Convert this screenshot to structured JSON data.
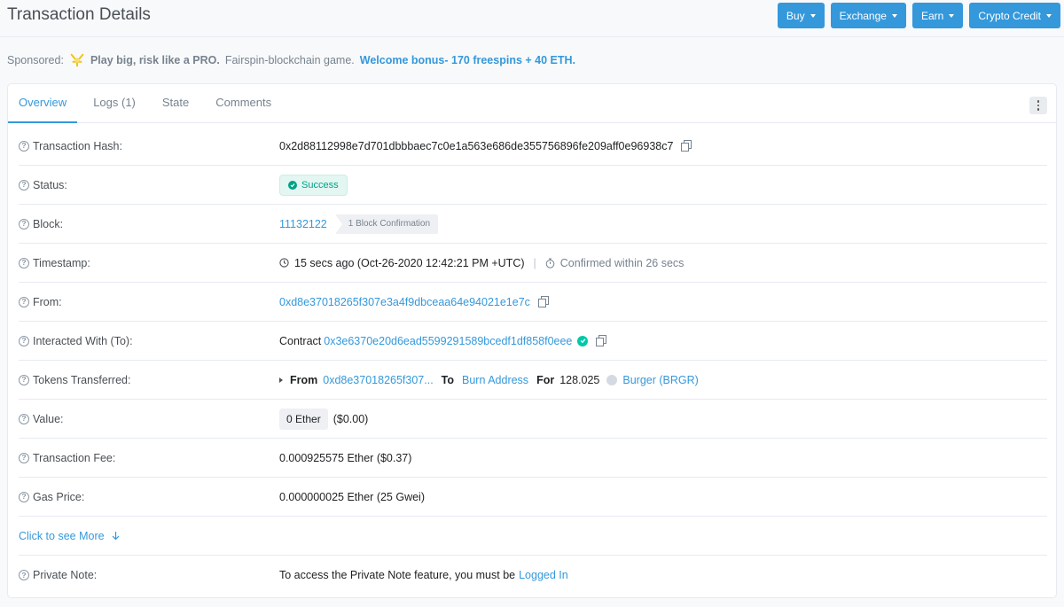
{
  "header": {
    "title": "Transaction Details",
    "buttons": [
      {
        "label": "Buy"
      },
      {
        "label": "Exchange"
      },
      {
        "label": "Earn"
      },
      {
        "label": "Crypto Credit"
      }
    ]
  },
  "sponsored": {
    "label": "Sponsored:",
    "headline": "Play big, risk like a PRO.",
    "text": "Fairspin-blockchain game.",
    "promo": "Welcome bonus- 170 freespins + 40 ETH."
  },
  "tabs": [
    {
      "label": "Overview",
      "active": true
    },
    {
      "label": "Logs (1)",
      "active": false
    },
    {
      "label": "State",
      "active": false
    },
    {
      "label": "Comments",
      "active": false
    }
  ],
  "details": {
    "tx_hash": {
      "label": "Transaction Hash:",
      "value": "0x2d88112998e7d701dbbbaec7c0e1a563e686de355756896fe209aff0e96938c7"
    },
    "status": {
      "label": "Status:",
      "value": "Success"
    },
    "block": {
      "label": "Block:",
      "number": "11132122",
      "confirmations": "1 Block Confirmation"
    },
    "timestamp": {
      "label": "Timestamp:",
      "value": "15 secs ago (Oct-26-2020 12:42:21 PM +UTC)",
      "separator": "|",
      "confirmed": "Confirmed within 26 secs"
    },
    "from": {
      "label": "From:",
      "value": "0xd8e37018265f307e3a4f9dbceaa64e94021e1e7c"
    },
    "to": {
      "label": "Interacted With (To):",
      "prefix": "Contract",
      "value": "0x3e6370e20d6ead5599291589bcedf1df858f0eee"
    },
    "tokens": {
      "label": "Tokens Transferred:",
      "from_label": "From",
      "from_value": "0xd8e37018265f307...",
      "to_label": "To",
      "to_value": "Burn Address",
      "for_label": "For",
      "amount": "128.025",
      "token": "Burger (BRGR)"
    },
    "value": {
      "label": "Value:",
      "ether": "0 Ether",
      "usd": "($0.00)"
    },
    "fee": {
      "label": "Transaction Fee:",
      "value": "0.000925575 Ether ($0.37)"
    },
    "gas": {
      "label": "Gas Price:",
      "value": "0.000000025 Ether (25 Gwei)"
    },
    "see_more": "Click to see More",
    "note": {
      "label": "Private Note:",
      "text": "To access the Private Note feature, you must be",
      "link": "Logged In"
    }
  },
  "colors": {
    "accent": "#3498db",
    "success": "#00a186",
    "page_bg": "#f8f9fa"
  },
  "icons": [
    "question-icon",
    "copy-icon",
    "check-circle-icon",
    "clock-icon",
    "stopwatch-icon",
    "verified-icon",
    "caret-down-icon",
    "arrow-down-icon",
    "more-vertical-icon",
    "token-icon"
  ]
}
